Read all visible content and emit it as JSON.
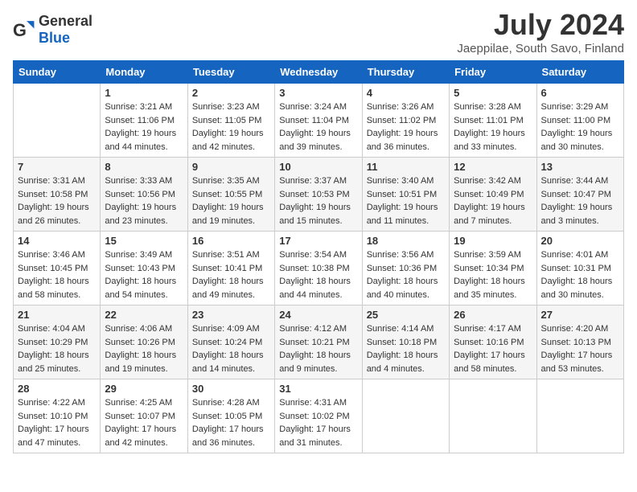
{
  "header": {
    "logo_general": "General",
    "logo_blue": "Blue",
    "title": "July 2024",
    "subtitle": "Jaeppilae, South Savo, Finland"
  },
  "columns": [
    "Sunday",
    "Monday",
    "Tuesday",
    "Wednesday",
    "Thursday",
    "Friday",
    "Saturday"
  ],
  "weeks": [
    [
      {
        "date": "",
        "sunrise": "",
        "sunset": "",
        "daylight": ""
      },
      {
        "date": "1",
        "sunrise": "Sunrise: 3:21 AM",
        "sunset": "Sunset: 11:06 PM",
        "daylight": "Daylight: 19 hours and 44 minutes."
      },
      {
        "date": "2",
        "sunrise": "Sunrise: 3:23 AM",
        "sunset": "Sunset: 11:05 PM",
        "daylight": "Daylight: 19 hours and 42 minutes."
      },
      {
        "date": "3",
        "sunrise": "Sunrise: 3:24 AM",
        "sunset": "Sunset: 11:04 PM",
        "daylight": "Daylight: 19 hours and 39 minutes."
      },
      {
        "date": "4",
        "sunrise": "Sunrise: 3:26 AM",
        "sunset": "Sunset: 11:02 PM",
        "daylight": "Daylight: 19 hours and 36 minutes."
      },
      {
        "date": "5",
        "sunrise": "Sunrise: 3:28 AM",
        "sunset": "Sunset: 11:01 PM",
        "daylight": "Daylight: 19 hours and 33 minutes."
      },
      {
        "date": "6",
        "sunrise": "Sunrise: 3:29 AM",
        "sunset": "Sunset: 11:00 PM",
        "daylight": "Daylight: 19 hours and 30 minutes."
      }
    ],
    [
      {
        "date": "7",
        "sunrise": "Sunrise: 3:31 AM",
        "sunset": "Sunset: 10:58 PM",
        "daylight": "Daylight: 19 hours and 26 minutes."
      },
      {
        "date": "8",
        "sunrise": "Sunrise: 3:33 AM",
        "sunset": "Sunset: 10:56 PM",
        "daylight": "Daylight: 19 hours and 23 minutes."
      },
      {
        "date": "9",
        "sunrise": "Sunrise: 3:35 AM",
        "sunset": "Sunset: 10:55 PM",
        "daylight": "Daylight: 19 hours and 19 minutes."
      },
      {
        "date": "10",
        "sunrise": "Sunrise: 3:37 AM",
        "sunset": "Sunset: 10:53 PM",
        "daylight": "Daylight: 19 hours and 15 minutes."
      },
      {
        "date": "11",
        "sunrise": "Sunrise: 3:40 AM",
        "sunset": "Sunset: 10:51 PM",
        "daylight": "Daylight: 19 hours and 11 minutes."
      },
      {
        "date": "12",
        "sunrise": "Sunrise: 3:42 AM",
        "sunset": "Sunset: 10:49 PM",
        "daylight": "Daylight: 19 hours and 7 minutes."
      },
      {
        "date": "13",
        "sunrise": "Sunrise: 3:44 AM",
        "sunset": "Sunset: 10:47 PM",
        "daylight": "Daylight: 19 hours and 3 minutes."
      }
    ],
    [
      {
        "date": "14",
        "sunrise": "Sunrise: 3:46 AM",
        "sunset": "Sunset: 10:45 PM",
        "daylight": "Daylight: 18 hours and 58 minutes."
      },
      {
        "date": "15",
        "sunrise": "Sunrise: 3:49 AM",
        "sunset": "Sunset: 10:43 PM",
        "daylight": "Daylight: 18 hours and 54 minutes."
      },
      {
        "date": "16",
        "sunrise": "Sunrise: 3:51 AM",
        "sunset": "Sunset: 10:41 PM",
        "daylight": "Daylight: 18 hours and 49 minutes."
      },
      {
        "date": "17",
        "sunrise": "Sunrise: 3:54 AM",
        "sunset": "Sunset: 10:38 PM",
        "daylight": "Daylight: 18 hours and 44 minutes."
      },
      {
        "date": "18",
        "sunrise": "Sunrise: 3:56 AM",
        "sunset": "Sunset: 10:36 PM",
        "daylight": "Daylight: 18 hours and 40 minutes."
      },
      {
        "date": "19",
        "sunrise": "Sunrise: 3:59 AM",
        "sunset": "Sunset: 10:34 PM",
        "daylight": "Daylight: 18 hours and 35 minutes."
      },
      {
        "date": "20",
        "sunrise": "Sunrise: 4:01 AM",
        "sunset": "Sunset: 10:31 PM",
        "daylight": "Daylight: 18 hours and 30 minutes."
      }
    ],
    [
      {
        "date": "21",
        "sunrise": "Sunrise: 4:04 AM",
        "sunset": "Sunset: 10:29 PM",
        "daylight": "Daylight: 18 hours and 25 minutes."
      },
      {
        "date": "22",
        "sunrise": "Sunrise: 4:06 AM",
        "sunset": "Sunset: 10:26 PM",
        "daylight": "Daylight: 18 hours and 19 minutes."
      },
      {
        "date": "23",
        "sunrise": "Sunrise: 4:09 AM",
        "sunset": "Sunset: 10:24 PM",
        "daylight": "Daylight: 18 hours and 14 minutes."
      },
      {
        "date": "24",
        "sunrise": "Sunrise: 4:12 AM",
        "sunset": "Sunset: 10:21 PM",
        "daylight": "Daylight: 18 hours and 9 minutes."
      },
      {
        "date": "25",
        "sunrise": "Sunrise: 4:14 AM",
        "sunset": "Sunset: 10:18 PM",
        "daylight": "Daylight: 18 hours and 4 minutes."
      },
      {
        "date": "26",
        "sunrise": "Sunrise: 4:17 AM",
        "sunset": "Sunset: 10:16 PM",
        "daylight": "Daylight: 17 hours and 58 minutes."
      },
      {
        "date": "27",
        "sunrise": "Sunrise: 4:20 AM",
        "sunset": "Sunset: 10:13 PM",
        "daylight": "Daylight: 17 hours and 53 minutes."
      }
    ],
    [
      {
        "date": "28",
        "sunrise": "Sunrise: 4:22 AM",
        "sunset": "Sunset: 10:10 PM",
        "daylight": "Daylight: 17 hours and 47 minutes."
      },
      {
        "date": "29",
        "sunrise": "Sunrise: 4:25 AM",
        "sunset": "Sunset: 10:07 PM",
        "daylight": "Daylight: 17 hours and 42 minutes."
      },
      {
        "date": "30",
        "sunrise": "Sunrise: 4:28 AM",
        "sunset": "Sunset: 10:05 PM",
        "daylight": "Daylight: 17 hours and 36 minutes."
      },
      {
        "date": "31",
        "sunrise": "Sunrise: 4:31 AM",
        "sunset": "Sunset: 10:02 PM",
        "daylight": "Daylight: 17 hours and 31 minutes."
      },
      {
        "date": "",
        "sunrise": "",
        "sunset": "",
        "daylight": ""
      },
      {
        "date": "",
        "sunrise": "",
        "sunset": "",
        "daylight": ""
      },
      {
        "date": "",
        "sunrise": "",
        "sunset": "",
        "daylight": ""
      }
    ]
  ]
}
